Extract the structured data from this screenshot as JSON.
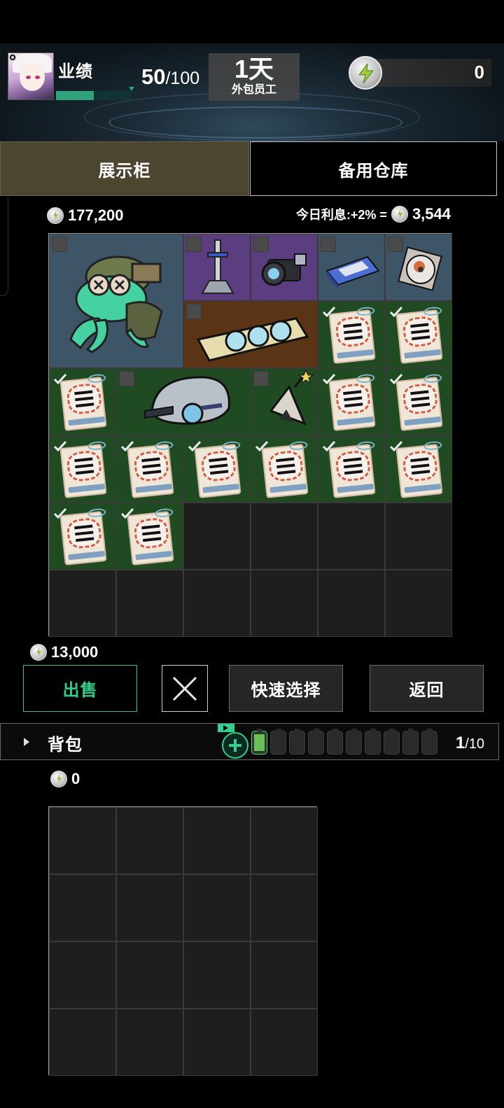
{
  "header": {
    "performance_label": "业绩",
    "performance_current": "50",
    "performance_max": "/100",
    "performance_fraction": 0.5,
    "day": "1天",
    "role": "外包员工",
    "energy": "0"
  },
  "tabs": [
    {
      "label": "展示柜",
      "active": true
    },
    {
      "label": "备用仓库",
      "active": false
    }
  ],
  "showcase": {
    "money": "177,200",
    "interest_label": "今日利息:+2% =",
    "interest_amount": "3,544",
    "items": [
      {
        "name": "frog-figurine",
        "selected": false
      },
      {
        "name": "sword-statue",
        "selected": false
      },
      {
        "name": "camera-lens",
        "selected": false
      },
      {
        "name": "storage-drive",
        "selected": false
      },
      {
        "name": "cd-disc",
        "selected": false
      },
      {
        "name": "graphics-card",
        "selected": false
      },
      {
        "name": "congratulation-card",
        "selected": true
      },
      {
        "name": "congratulation-card",
        "selected": true
      },
      {
        "name": "congratulation-card",
        "selected": true
      },
      {
        "name": "helmet",
        "selected": false
      },
      {
        "name": "onigiri-wand",
        "selected": false
      },
      {
        "name": "congratulation-card",
        "selected": true
      },
      {
        "name": "congratulation-card",
        "selected": true
      },
      {
        "name": "congratulation-card",
        "selected": true
      },
      {
        "name": "congratulation-card",
        "selected": true
      },
      {
        "name": "congratulation-card",
        "selected": true
      },
      {
        "name": "congratulation-card",
        "selected": true
      },
      {
        "name": "congratulation-card",
        "selected": true
      },
      {
        "name": "congratulation-card",
        "selected": true
      },
      {
        "name": "congratulation-card",
        "selected": true
      },
      {
        "name": "congratulation-card",
        "selected": true
      }
    ]
  },
  "selection_value": "13,000",
  "actions": {
    "sell": "出售",
    "quick_select": "快速选择",
    "back": "返回"
  },
  "backpack": {
    "title": "背包",
    "count": "1",
    "max": "/10",
    "money": "0"
  },
  "colors": {
    "accent_green": "#2fd18e",
    "tab_active": "#4c4530",
    "rarity_blue": "#3d5566",
    "rarity_purple": "#5a3e7f",
    "rarity_orange": "#5b3416",
    "rarity_green": "#1f4a22"
  }
}
